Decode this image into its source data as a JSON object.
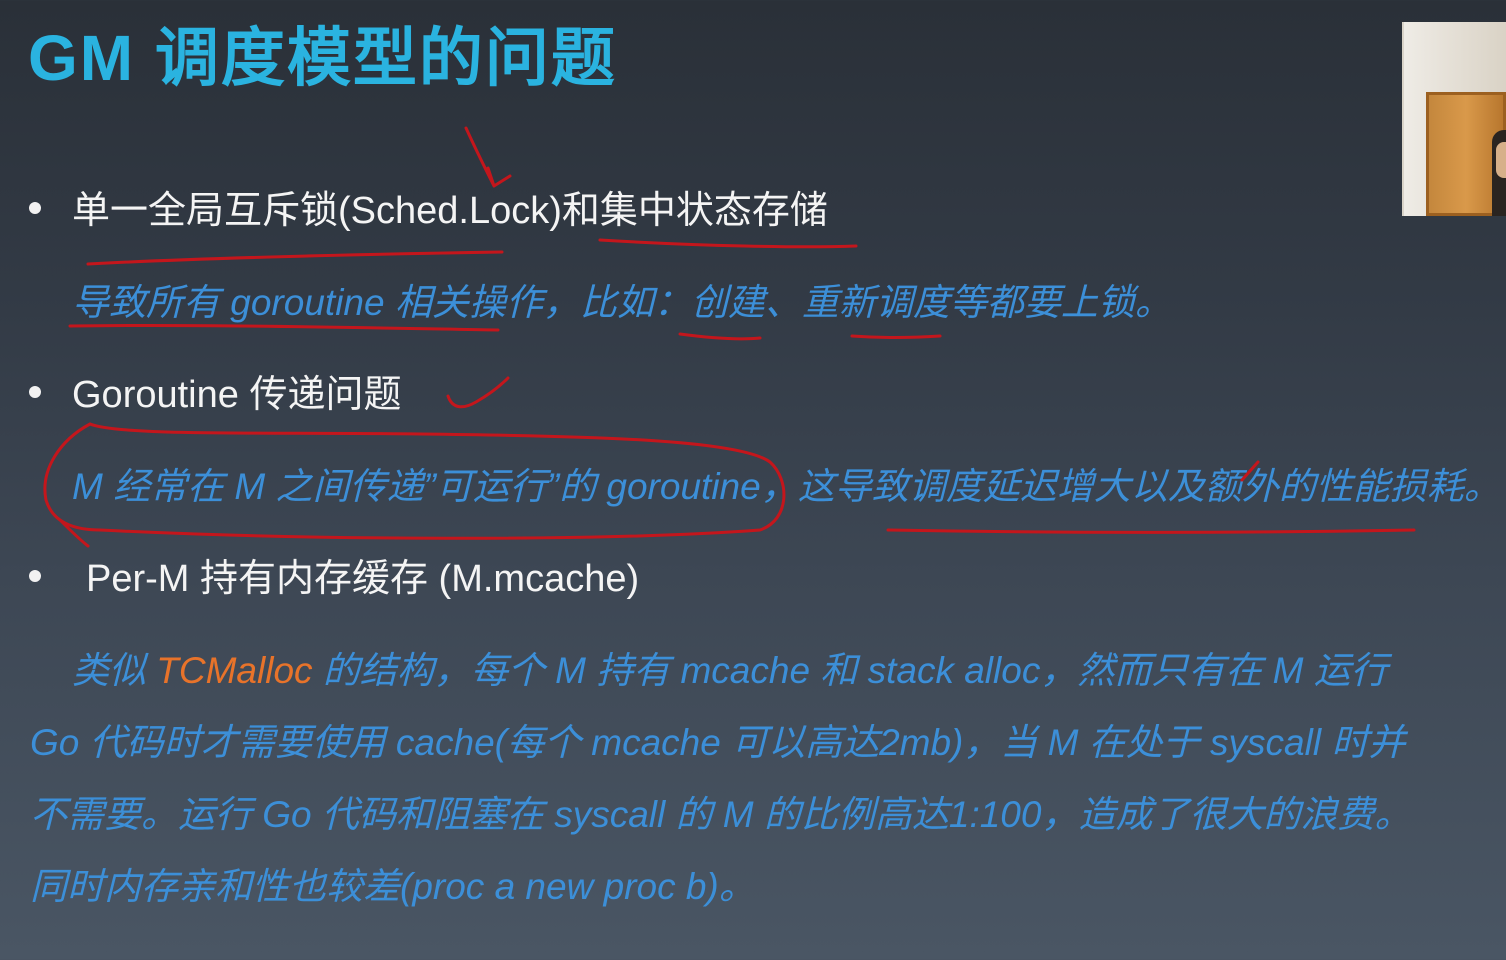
{
  "slide": {
    "title": "GM 调度模型的问题",
    "bullets": [
      {
        "text": "单一全局互斥锁(Sched.Lock)和集中状态存储",
        "detail": "导致所有 goroutine 相关操作，比如：创建、重新调度等都要上锁。"
      },
      {
        "text": "Goroutine 传递问题",
        "detail": "M 经常在 M 之间传递”可运行”的 goroutine，这导致调度延迟增大以及额外的性能损耗。"
      },
      {
        "text": "Per-M 持有内存缓存 (M.mcache)",
        "detail_prefix": "类似 ",
        "detail_highlight": "TCMalloc",
        "detail_line1_rest": " 的结构，每个 M 持有 mcache 和 stack alloc，然而只有在 M 运行",
        "detail_line2": "Go 代码时才需要使用 cache(每个 mcache 可以高达2mb)，当 M 在处于 syscall 时并",
        "detail_line3": "不需要。运行 Go 代码和阻塞在 syscall 的 M 的比例高达1:100，造成了很大的浪费。",
        "detail_line4": "同时内存亲和性也较差(proc a new proc b)。"
      }
    ],
    "colors": {
      "title": "#2ab3e0",
      "detail": "#3c8fd8",
      "highlight": "#e8732a",
      "annotation": "#c4161c"
    }
  }
}
